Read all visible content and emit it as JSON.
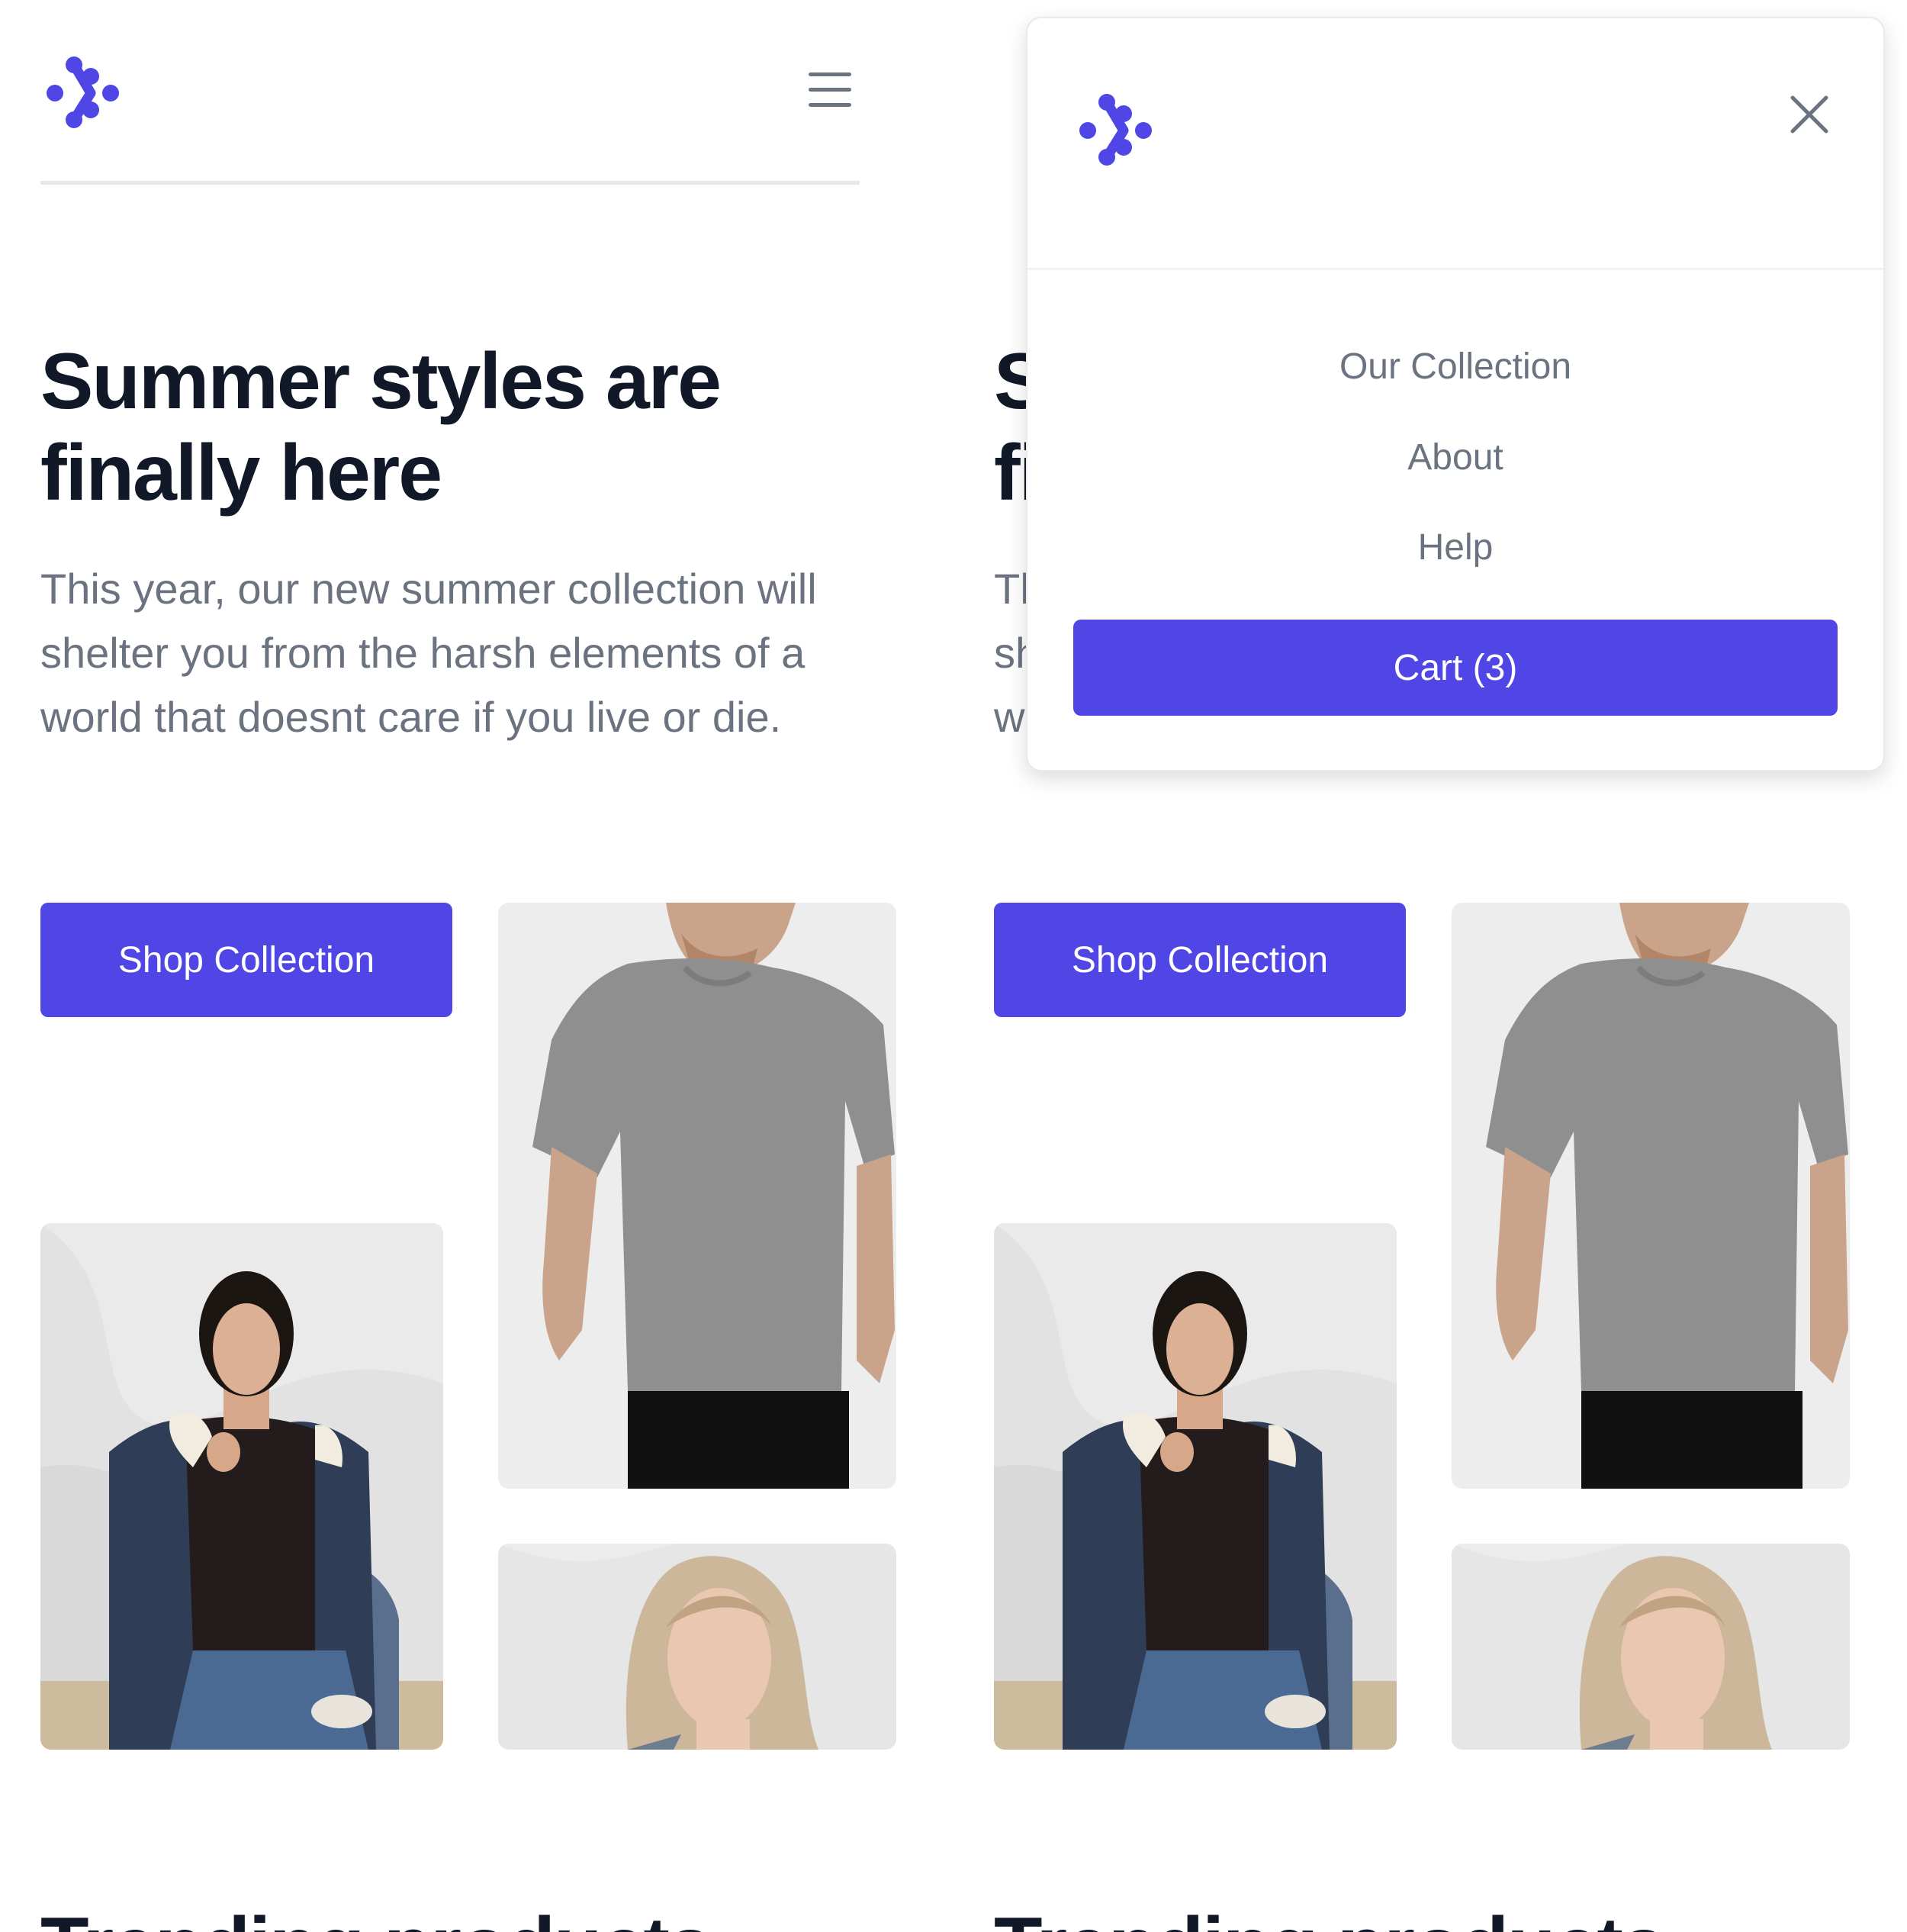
{
  "brand": {
    "accent_color": "#4f46e5",
    "logo_icon": "dots-logo-icon"
  },
  "header": {
    "menu_icon": "hamburger-menu-icon"
  },
  "hero": {
    "title": "Summer styles are finally here",
    "text": "This year, our new summer collection will shelter you from the harsh elements of a world that doesnt care if you live or die.",
    "shop_button_label": "Shop Collection",
    "images": [
      {
        "description": "woman in denim jacket with sherpa collar"
      },
      {
        "description": "man in grey t-shirt"
      },
      {
        "description": "woman with blonde hair"
      }
    ]
  },
  "trending": {
    "title": "Trending products"
  },
  "mobile_menu": {
    "close_icon": "close-icon",
    "items": [
      {
        "label": "Our Collection"
      },
      {
        "label": "About"
      },
      {
        "label": "Help"
      }
    ],
    "cart_label": "Cart (3)"
  }
}
